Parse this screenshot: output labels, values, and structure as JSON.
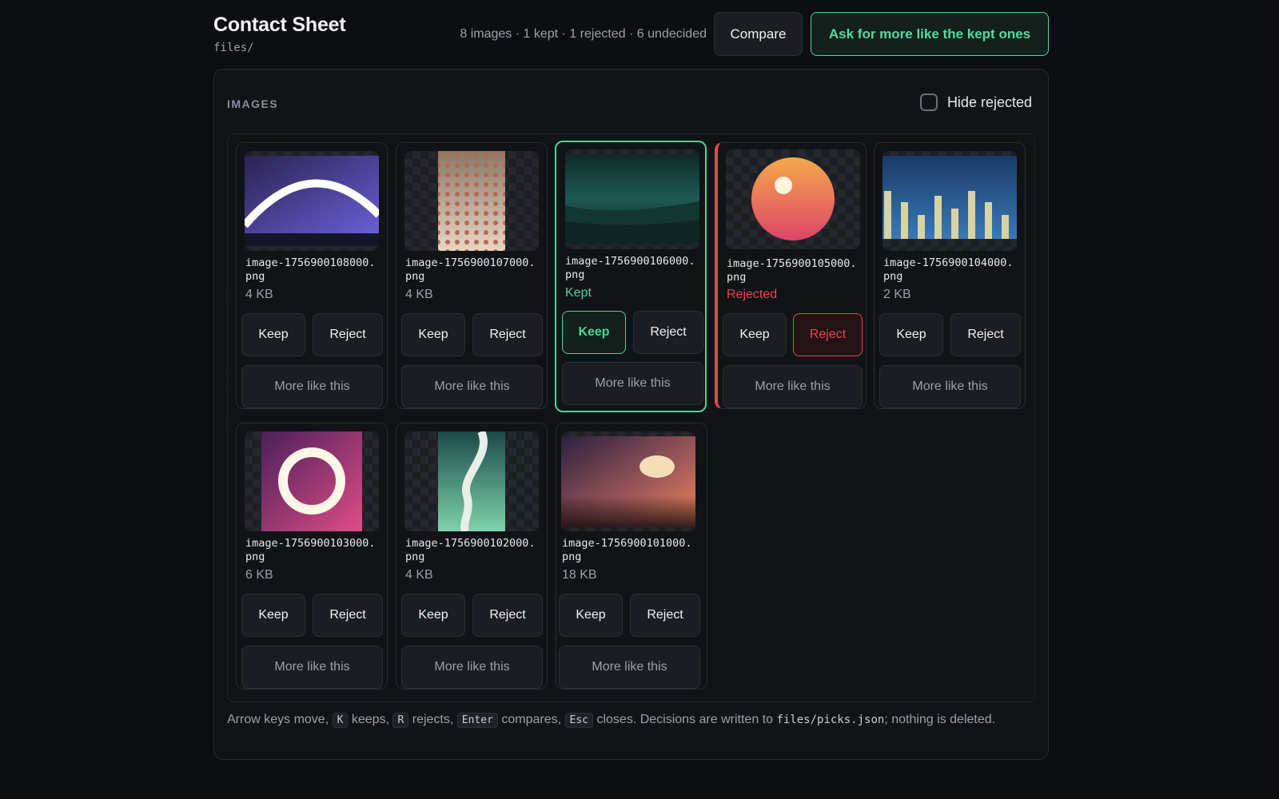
{
  "header": {
    "title": "Contact Sheet",
    "path": "files/",
    "stats": "8 images · 1 kept · 1 rejected · 6 undecided",
    "compare_label": "Compare",
    "ask_label": "Ask for more like the kept ones"
  },
  "panel": {
    "section_label": "IMAGES",
    "hide_rejected_label": "Hide rejected",
    "hide_rejected_checked": false
  },
  "images": [
    {
      "name": "image-1756900108000.png",
      "meta": "4 KB",
      "status": "undecided"
    },
    {
      "name": "image-1756900107000.png",
      "meta": "4 KB",
      "status": "undecided"
    },
    {
      "name": "image-1756900106000.png",
      "meta": "Kept",
      "status": "kept"
    },
    {
      "name": "image-1756900105000.png",
      "meta": "Rejected",
      "status": "rejected"
    },
    {
      "name": "image-1756900104000.png",
      "meta": "2 KB",
      "status": "undecided"
    },
    {
      "name": "image-1756900103000.png",
      "meta": "6 KB",
      "status": "undecided"
    },
    {
      "name": "image-1756900102000.png",
      "meta": "4 KB",
      "status": "undecided"
    },
    {
      "name": "image-1756900101000.png",
      "meta": "18 KB",
      "status": "undecided"
    }
  ],
  "card_buttons": {
    "keep": "Keep",
    "reject": "Reject",
    "more": "More like this"
  },
  "footer": {
    "t1": "Arrow keys move,",
    "k1": "K",
    "t2": "keeps,",
    "k2": "R",
    "t3": "rejects,",
    "k3": "Enter",
    "t4": "compares,",
    "k4": "Esc",
    "t5": "closes. Decisions are written to",
    "file": "files/picks.json",
    "t6": "; nothing is deleted."
  },
  "colors": {
    "kept": "#4fd39a",
    "rejected": "#e5484d",
    "background": "#0d0e11"
  }
}
